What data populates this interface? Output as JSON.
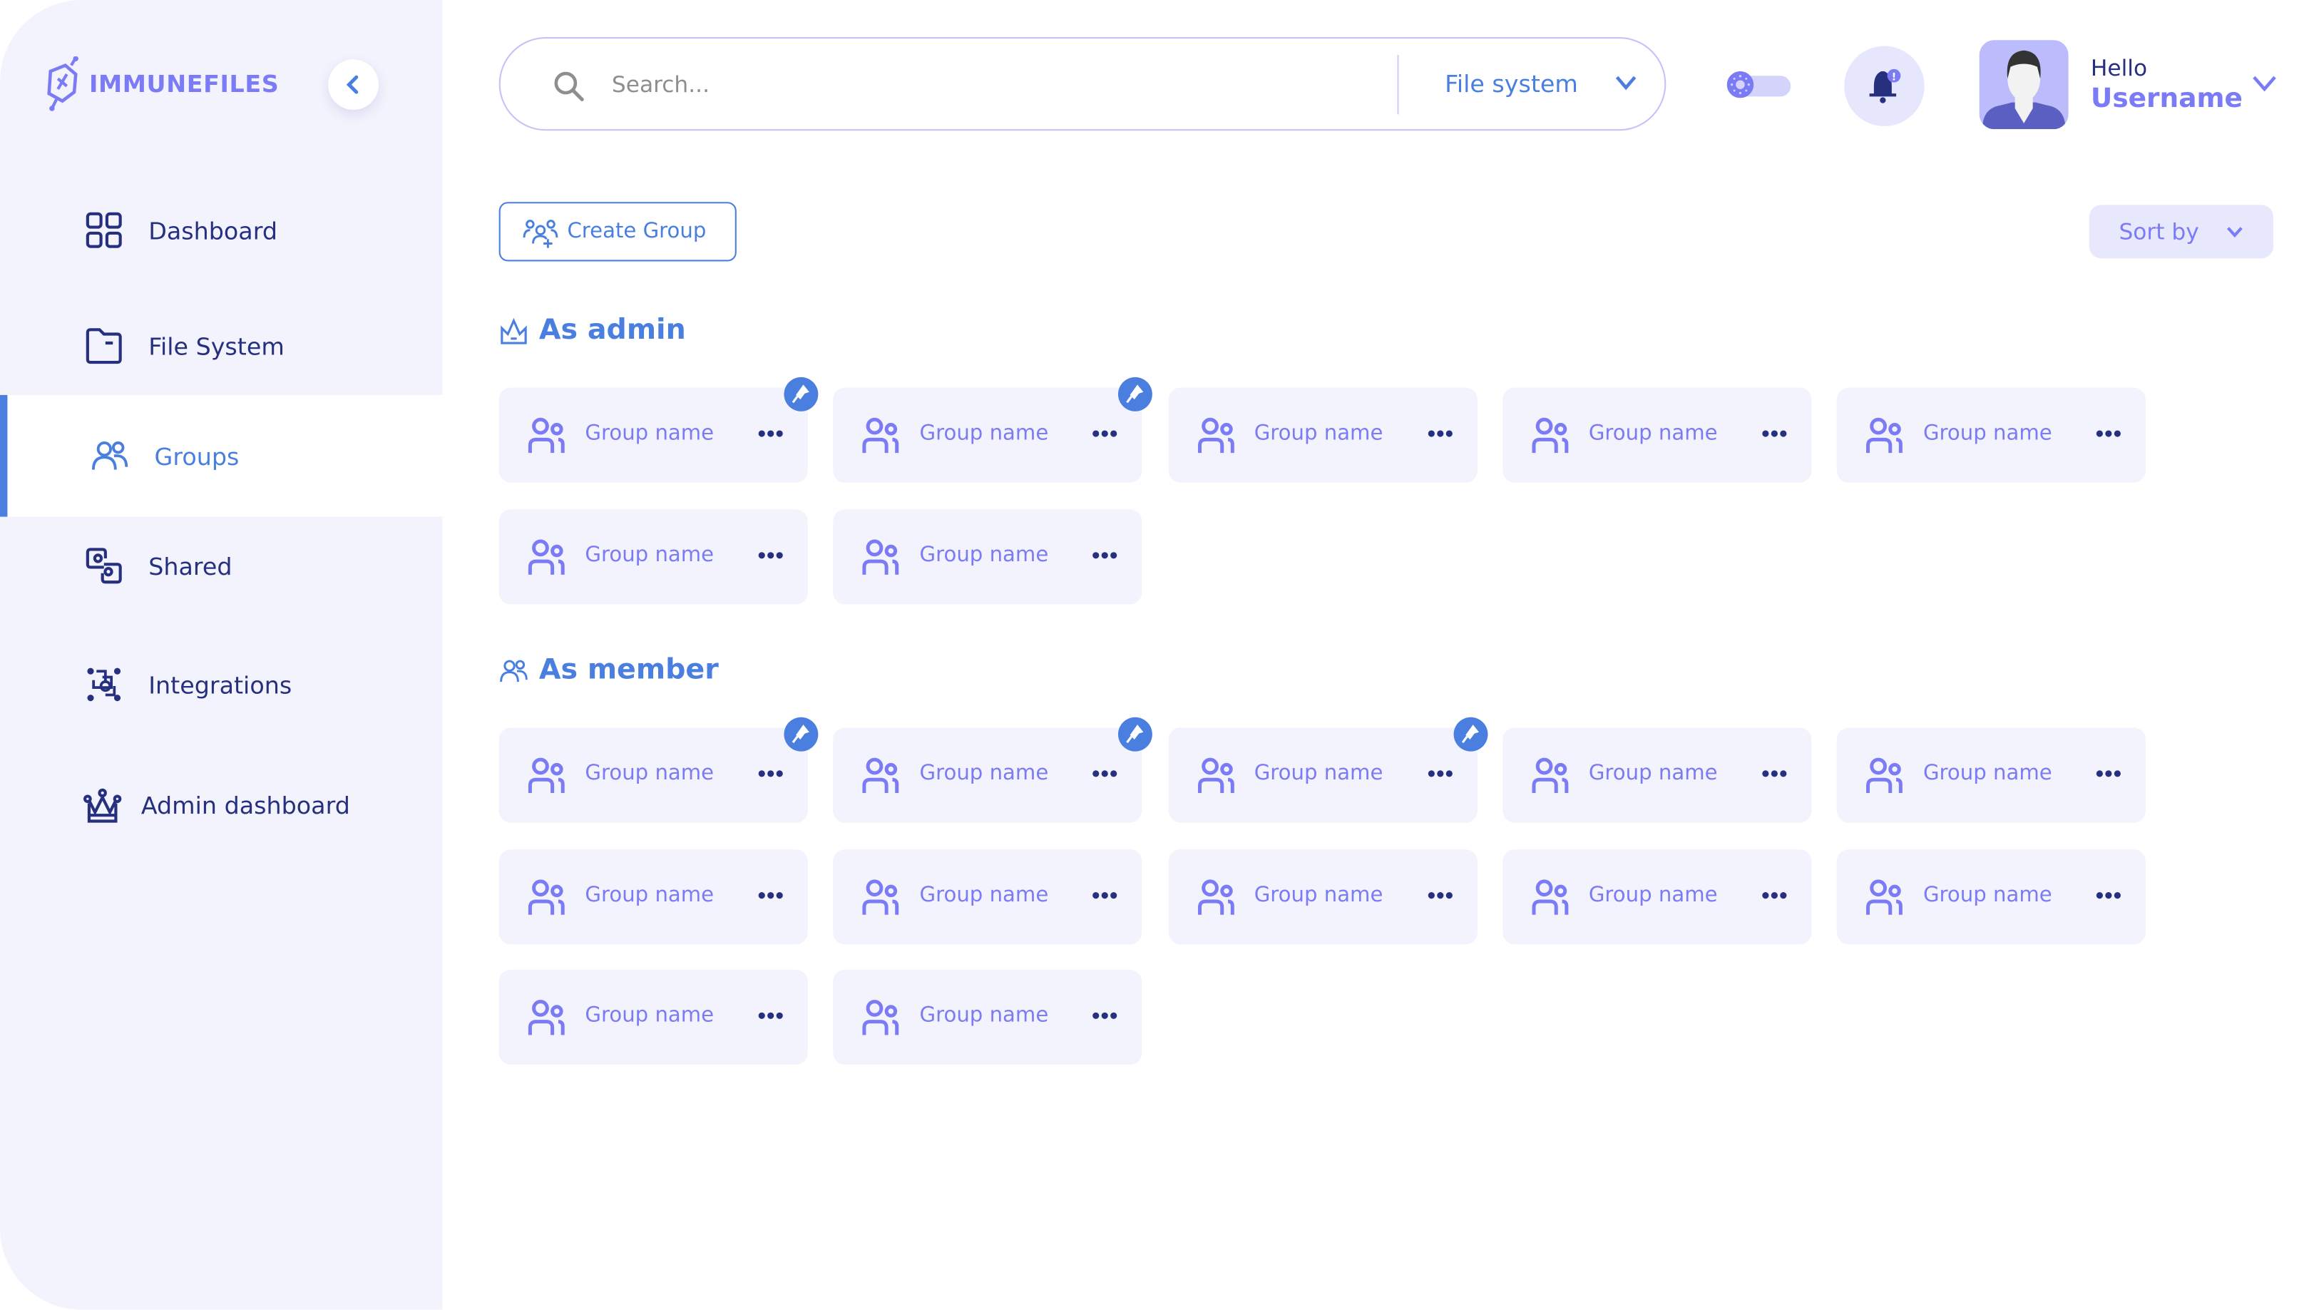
{
  "brand": {
    "name": "IMMUNEFILES",
    "logo_icon": "shield-logo-icon"
  },
  "colors": {
    "accent": "#4a7fe0",
    "purple": "#7b7bf5",
    "navy": "#26307f",
    "sidebar_bg": "#f3f3fd",
    "card_bg": "#f3f3fd"
  },
  "sidebar": {
    "items": [
      {
        "label": "Dashboard",
        "icon": "grid-icon",
        "active": false
      },
      {
        "label": "File System",
        "icon": "folder-icon",
        "active": false
      },
      {
        "label": "Groups",
        "icon": "users-icon",
        "active": true
      },
      {
        "label": "Shared",
        "icon": "shared-icon",
        "active": false
      },
      {
        "label": "Integrations",
        "icon": "integrations-icon",
        "active": false
      },
      {
        "label": "Admin dashboard",
        "icon": "crown-icon",
        "active": false
      }
    ]
  },
  "header": {
    "search_placeholder": "Search...",
    "scope": "File system",
    "greeting": "Hello",
    "username": "Username",
    "theme_toggle": "light",
    "notification_alert": "!"
  },
  "toolbar": {
    "create_group": "Create Group",
    "sort_by": "Sort by"
  },
  "sections": {
    "admin": {
      "title": "As admin",
      "groups": [
        {
          "name": "Group name",
          "pinned": true
        },
        {
          "name": "Group name",
          "pinned": true
        },
        {
          "name": "Group name",
          "pinned": false
        },
        {
          "name": "Group name",
          "pinned": false
        },
        {
          "name": "Group name",
          "pinned": false
        },
        {
          "name": "Group name",
          "pinned": false
        },
        {
          "name": "Group name",
          "pinned": false
        }
      ]
    },
    "member": {
      "title": "As member",
      "groups": [
        {
          "name": "Group name",
          "pinned": true
        },
        {
          "name": "Group name",
          "pinned": true
        },
        {
          "name": "Group name",
          "pinned": true
        },
        {
          "name": "Group name",
          "pinned": false
        },
        {
          "name": "Group name",
          "pinned": false
        },
        {
          "name": "Group name",
          "pinned": false
        },
        {
          "name": "Group name",
          "pinned": false
        },
        {
          "name": "Group name",
          "pinned": false
        },
        {
          "name": "Group name",
          "pinned": false
        },
        {
          "name": "Group name",
          "pinned": false
        },
        {
          "name": "Group name",
          "pinned": false
        },
        {
          "name": "Group name",
          "pinned": false
        }
      ]
    }
  }
}
